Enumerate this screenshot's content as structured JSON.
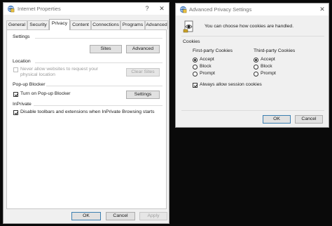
{
  "internet_properties": {
    "title": "Internet Properties",
    "help_glyph": "?",
    "close_glyph": "✕",
    "tabs": [
      {
        "label": "General"
      },
      {
        "label": "Security"
      },
      {
        "label": "Privacy",
        "active": true
      },
      {
        "label": "Content"
      },
      {
        "label": "Connections"
      },
      {
        "label": "Programs"
      },
      {
        "label": "Advanced"
      }
    ],
    "settings": {
      "group_label": "Settings",
      "sites_button": "Sites",
      "advanced_button": "Advanced"
    },
    "location": {
      "group_label": "Location",
      "checkbox_label_line1": "Never allow websites to request your",
      "checkbox_label_line2": "physical location",
      "checked": false,
      "enabled": false,
      "clear_sites_button": "Clear Sites"
    },
    "popup_blocker": {
      "group_label": "Pop-up Blocker",
      "checkbox_label": "Turn on Pop-up Blocker",
      "checked": true,
      "settings_button": "Settings"
    },
    "inprivate": {
      "group_label": "InPrivate",
      "checkbox_label": "Disable toolbars and extensions when InPrivate Browsing starts",
      "checked": true
    },
    "footer": {
      "ok": "OK",
      "cancel": "Cancel",
      "apply": "Apply",
      "apply_enabled": false
    }
  },
  "advanced_privacy": {
    "title": "Advanced Privacy Settings",
    "close_glyph": "✕",
    "description": "You can choose how cookies are handled.",
    "cookies_label": "Cookies",
    "first_party": {
      "label": "First-party Cookies",
      "options": [
        "Accept",
        "Block",
        "Prompt"
      ],
      "selected": "Accept"
    },
    "third_party": {
      "label": "Third-party Cookies",
      "options": [
        "Accept",
        "Block",
        "Prompt"
      ],
      "selected": "Accept"
    },
    "session_cookies_label": "Always allow session cookies",
    "session_cookies_checked": true,
    "ok": "OK",
    "cancel": "Cancel"
  },
  "colors": {
    "desktop": "#0a0a0a",
    "dialog_bg": "#f0f0f0",
    "panel_bg": "#ffffff",
    "button_bg": "#e1e1e1",
    "default_button_border": "#3c7fb1"
  },
  "icons": {
    "internet_properties": "internet-options-icon",
    "advanced_privacy": "internet-options-icon",
    "cookie_info": "privacy-eye-icon"
  }
}
